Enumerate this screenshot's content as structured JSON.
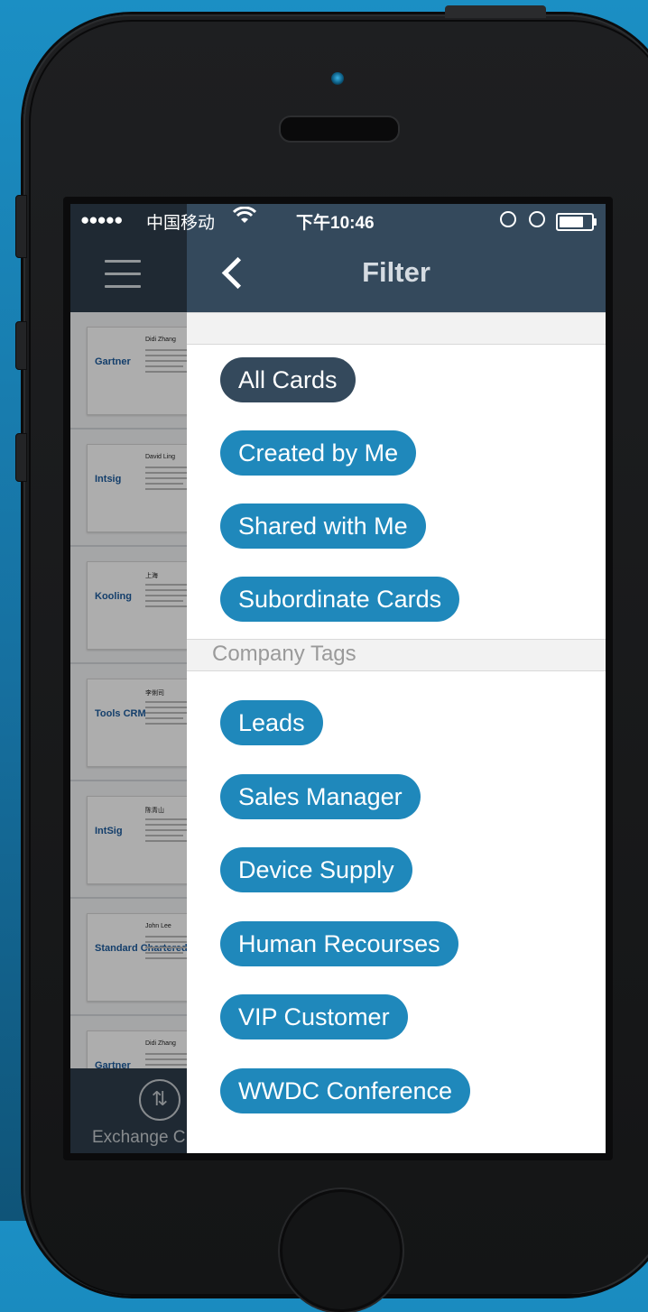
{
  "status_bar": {
    "signal": "●●●●●",
    "carrier": "中国移动",
    "time": "下午10:46"
  },
  "background_app": {
    "cards": [
      {
        "logo": "Gartner",
        "name": "Didi Zhang"
      },
      {
        "logo": "Intsig",
        "name": "David Ling"
      },
      {
        "logo": "Kooling",
        "name": "上海"
      },
      {
        "logo": "Tools CRM",
        "name": "李俐司"
      },
      {
        "logo": "IntSig",
        "name": "陈青山"
      },
      {
        "logo": "Standard Chartered",
        "name": "John Lee"
      },
      {
        "logo": "Gartner",
        "name": "Didi Zhang"
      }
    ],
    "tab_label": "Exchange C"
  },
  "filter": {
    "title": "Filter",
    "card_filters": [
      {
        "label": "All Cards",
        "selected": true
      },
      {
        "label": "Created by Me",
        "selected": false
      },
      {
        "label": "Shared with Me",
        "selected": false
      },
      {
        "label": "Subordinate Cards",
        "selected": false
      }
    ],
    "company_tags_header": "Company Tags",
    "company_tags": [
      {
        "label": "Leads"
      },
      {
        "label": "Sales Manager"
      },
      {
        "label": "Device Supply"
      },
      {
        "label": "Human Recourses"
      },
      {
        "label": "VIP Customer"
      },
      {
        "label": "WWDC Conference"
      }
    ]
  },
  "colors": {
    "navbar": "#34495c",
    "pill_blue": "#1f88bb",
    "pill_selected": "#34495c"
  }
}
